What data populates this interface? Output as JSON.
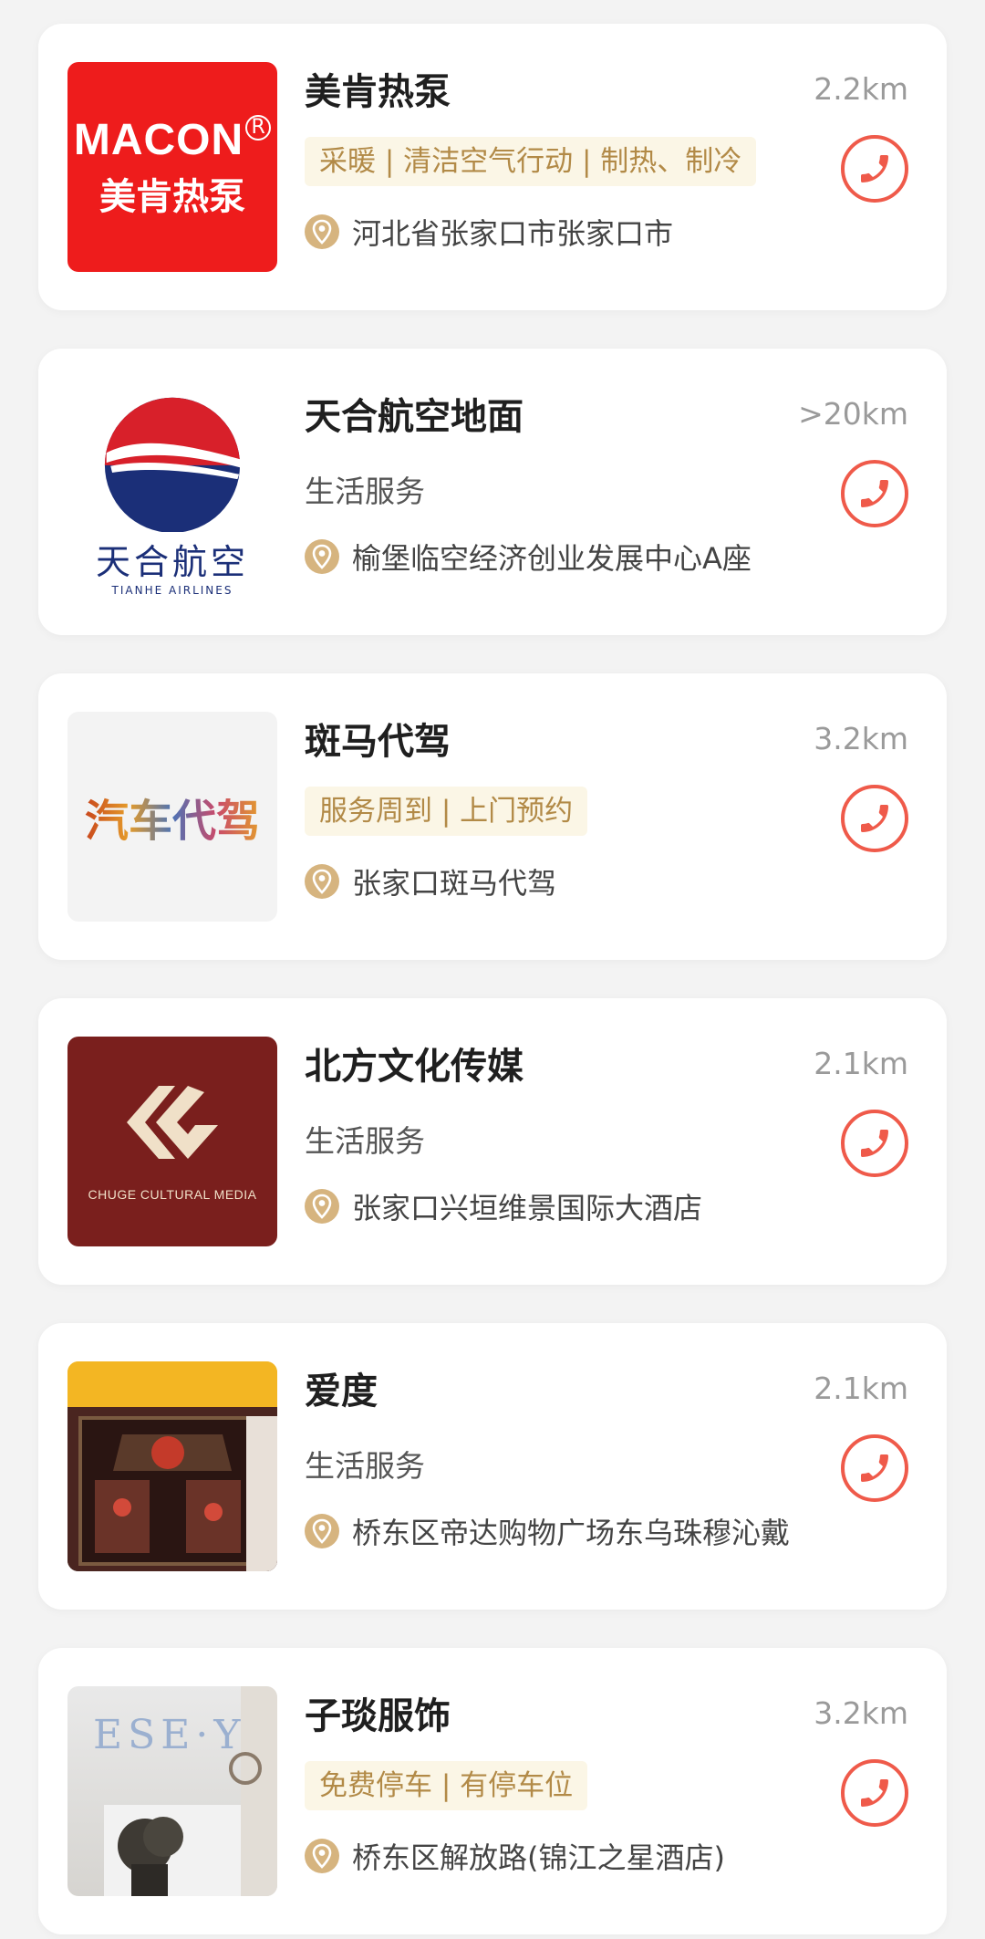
{
  "colors": {
    "tag_bg": "#fbf6e6",
    "tag_text": "#b28a47",
    "phone_accent": "#ef5a4a",
    "pin_bg": "#d6b47f"
  },
  "listings": [
    {
      "title": "美肯热泵",
      "distance": "2.2km",
      "tags": "采暖 | 清洁空气行动 | 制热、制冷",
      "address": "河北省张家口市张家口市",
      "logo_text_en": "MACON",
      "logo_text_cn": "美肯热泵",
      "logo_mark": "®"
    },
    {
      "title": "天合航空地面",
      "distance": ">20km",
      "category": "生活服务",
      "address": "榆堡临空经济创业发展中心A座",
      "logo_text_cn": "天合航空",
      "logo_text_en": "TIANHE AIRLINES"
    },
    {
      "title": "斑马代驾",
      "distance": "3.2km",
      "tags": "服务周到 | 上门预约",
      "address": "张家口斑马代驾",
      "logo_text_cn": "汽车代驾"
    },
    {
      "title": "北方文化传媒",
      "distance": "2.1km",
      "category": "生活服务",
      "address": "张家口兴垣维景国际大酒店",
      "logo_text_en": "CHUGE CULTURAL MEDIA"
    },
    {
      "title": "爱度",
      "distance": "2.1km",
      "category": "生活服务",
      "address": "桥东区帝达购物广场东乌珠穆沁戴"
    },
    {
      "title": "子琰服饰",
      "distance": "3.2km",
      "tags": "免费停车 | 有停车位",
      "address": "桥东区解放路(锦江之星酒店)",
      "logo_text_en": "ESE·Y"
    }
  ]
}
